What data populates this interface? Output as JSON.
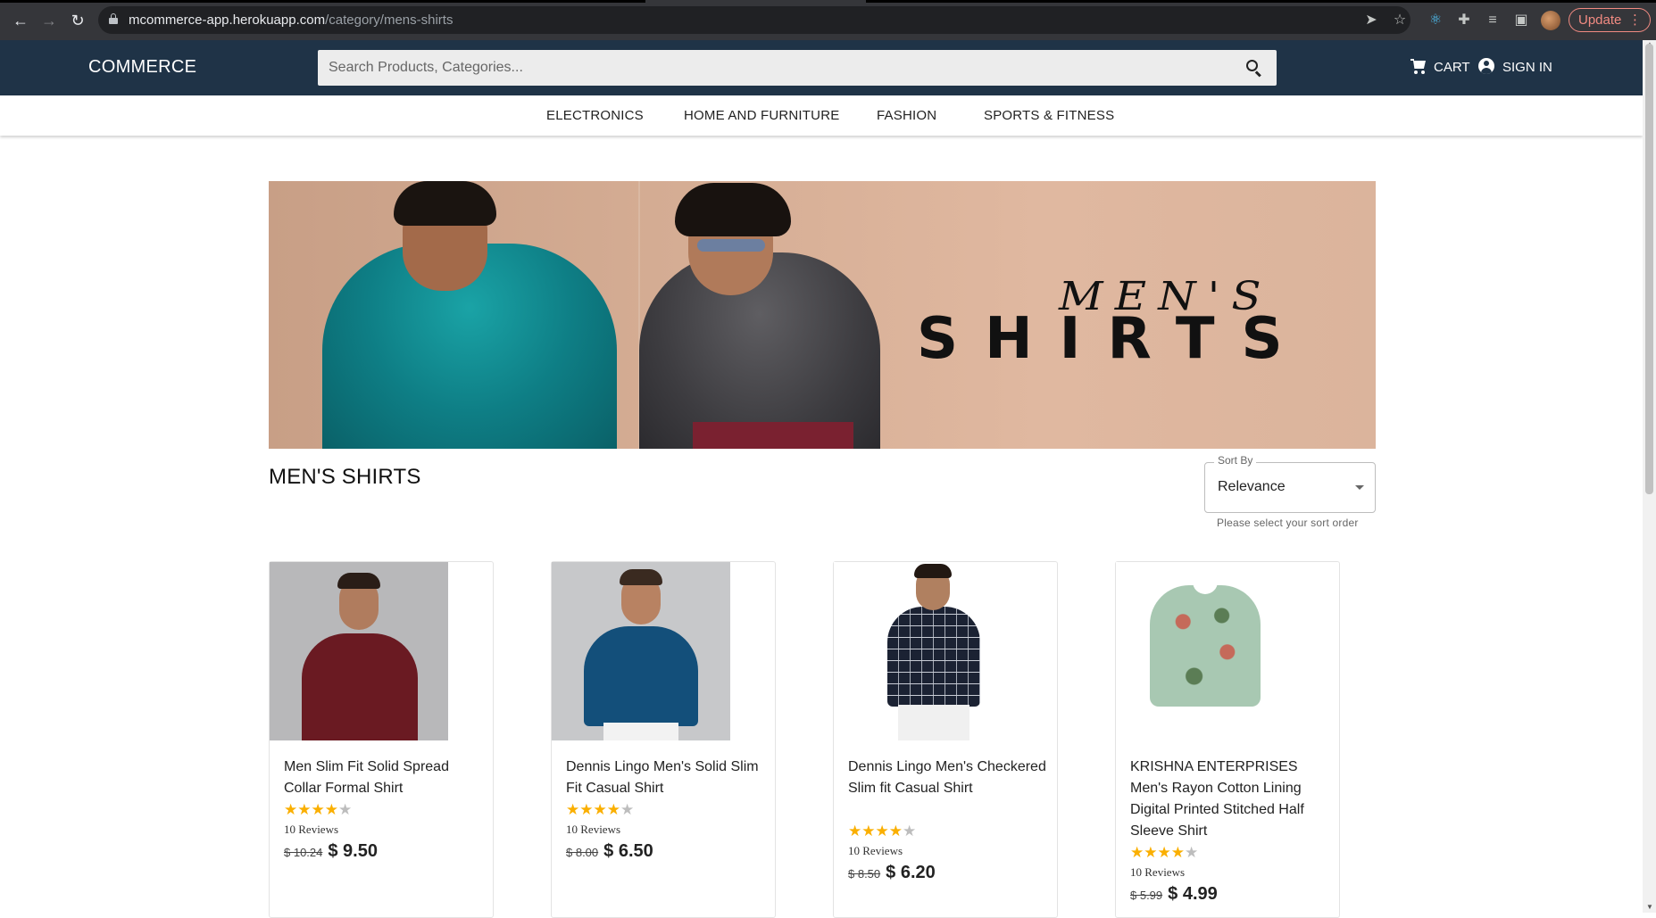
{
  "browser": {
    "url_domain": "mcommerce-app.herokuapp.com",
    "url_path": "/category/mens-shirts",
    "update_label": "Update",
    "update_dots": "⋮"
  },
  "header": {
    "logo": "COMMERCE",
    "search_placeholder": "Search Products, Categories...",
    "cart_label": "CART",
    "signin_label": "SIGN IN"
  },
  "categories": [
    "ELECTRONICS",
    "HOME AND FURNITURE",
    "FASHION",
    "SPORTS & FITNESS"
  ],
  "banner": {
    "title_line1": "MEN'S",
    "title_line2": "SHIRTS"
  },
  "page": {
    "title": "MEN'S SHIRTS"
  },
  "sort": {
    "label": "Sort By",
    "value": "Relevance",
    "helper": "Please select your sort order"
  },
  "products": [
    {
      "title": "Men Slim Fit Solid Spread Collar Formal Shirt",
      "rating": 3.5,
      "stars": "★★★★★",
      "reviews": "10 Reviews",
      "old_price": "$ 10.24",
      "price": "$ 9.50"
    },
    {
      "title": "Dennis Lingo Men's Solid Slim Fit Casual Shirt",
      "rating": 3.5,
      "stars": "★★★★★",
      "reviews": "10 Reviews",
      "old_price": "$ 8.00",
      "price": "$ 6.50"
    },
    {
      "title": "Dennis Lingo Men's Checkered Slim fit Casual Shirt",
      "rating": 3.5,
      "stars": "★★★★★",
      "reviews": "10 Reviews",
      "old_price": "$ 8.50",
      "price": "$ 6.20"
    },
    {
      "title": "KRISHNA ENTERPRISES Men's Rayon Cotton Lining Digital Printed Stitched Half Sleeve Shirt",
      "rating": 3.5,
      "stars": "★★★★★",
      "reviews": "10 Reviews",
      "old_price": "$ 5.99",
      "price": "$ 4.99"
    }
  ],
  "colors": {
    "header_bg": "#1f3347",
    "star": "#faaf00",
    "update": "#f28b82"
  },
  "icons": [
    "back-icon",
    "forward-icon",
    "reload-icon",
    "lock-icon",
    "send-icon",
    "star-bookmark-icon",
    "react-devtools-icon",
    "extensions-icon",
    "media-icon",
    "sidepanel-icon",
    "profile-avatar",
    "search-icon",
    "cart-icon",
    "account-circle-icon",
    "dropdown-caret-icon"
  ]
}
